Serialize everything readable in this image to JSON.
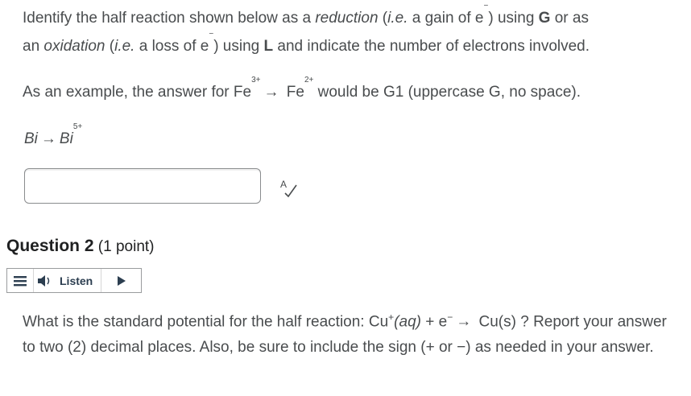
{
  "question1": {
    "line1_a": "Identify the half reaction shown below as a ",
    "line1_reduction": "reduction",
    "line1_b": " (",
    "line1_ie1": "i.e.",
    "line1_c": " a gain of e",
    "line1_d": ") using ",
    "line1_G": "G",
    "line1_e": " or as",
    "line2_a": "an ",
    "line2_oxidation": "oxidation",
    "line2_b": " (",
    "line2_ie2": "i.e.",
    "line2_c": " a loss of e",
    "line2_d": ") using ",
    "line2_L": "L",
    "line2_e": " and indicate the number of electrons involved.",
    "example_a": "As an example, the answer for Fe",
    "example_sup1": "3+",
    "example_arrow": "→",
    "example_b": " Fe",
    "example_sup2": "2+",
    "example_c": " would be G1 (uppercase G, no space).",
    "equation_left": "Bi",
    "equation_arrow": "→",
    "equation_right": "Bi",
    "equation_sup": "5+",
    "answer_value": ""
  },
  "question2": {
    "title_bold": "Question 2",
    "title_points": " (1 point)",
    "listen_label": "Listen",
    "text_a": "What is the standard potential for the half reaction: Cu",
    "text_sup": "+",
    "text_aq": "(aq)",
    "text_b": " + e",
    "text_sup2": "−",
    "text_arrow": "→",
    "text_c": " Cu(s) ? Report your answer to two (2) decimal places. Also, be sure to include the sign (+ or −) as needed in your answer."
  },
  "icons": {
    "spellcheck": "spellcheck-icon",
    "menu": "menu-icon",
    "speaker": "speaker-icon",
    "play": "play-icon"
  }
}
